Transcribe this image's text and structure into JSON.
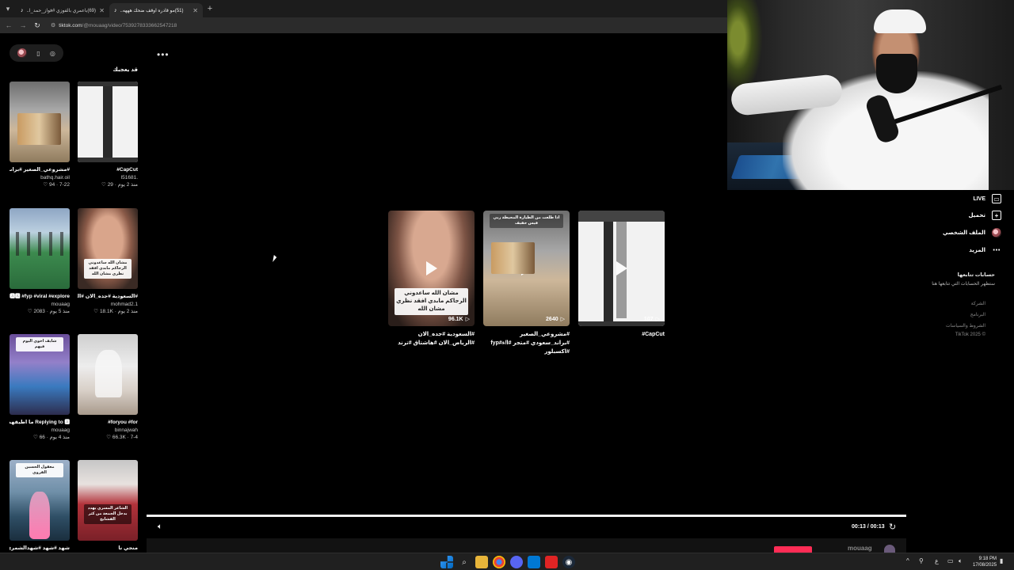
{
  "browser": {
    "tabs": [
      {
        "title": "(69)باعمري بالفوزي #فواز_حمد_ا..",
        "active": false
      },
      {
        "title": "(51)مو قادره اوقف ضحك هههه..",
        "active": true
      }
    ],
    "new_tab": "+",
    "url_host": "tiktok.com",
    "url_path": "/@mouaag/video/7539278333662547218"
  },
  "header": {
    "more": "•••"
  },
  "related": {
    "title": "قد يعجبك",
    "items": [
      {
        "caption": "CapCut#",
        "author": "I51681.",
        "meta": "29 · منذ 2 يوم"
      },
      {
        "caption": "#مشروعي_الصغير #براند_سعودي #متجر...",
        "author": "bathq.hair.oil",
        "meta": "94 · 7-22"
      },
      {
        "caption": "#السعودية #جده_الان #الرياض_الان #هاشتاق...",
        "author": "mohmad2.1",
        "meta": "18.1K · منذ 2 يوم",
        "overlay": "مشان الله ساعدوني الرجاكم مابدي افقد نظري مشان الله"
      },
      {
        "caption": "tu# 🅰🅰🅰 #fyp #viral #explore...",
        "author": "mouaag",
        "meta": "2083 · منذ 5 يوم"
      },
      {
        "caption": "foryou #for#",
        "author": "binnajwah",
        "meta": "66.3K · 7-4"
      },
      {
        "caption": "Replying to 🅰 ما اطيقهم بحلقراك 🅰 #fyp# tu...",
        "author": "mouaag",
        "meta": "66 · منذ 4 يوم",
        "overlay": "شايف اخوي اليوم فيهم"
      },
      {
        "caption": "منجي نا",
        "author": "",
        "meta": "",
        "overlay": "الشاعر المسري يهدد بدخل الجمعة من كثر الفشايخ"
      },
      {
        "caption": "شهد #شهد #شهدالشمري",
        "author": "",
        "meta": "",
        "overlay": "معقول الحسين القروي"
      }
    ]
  },
  "main_videos": [
    {
      "views": "107",
      "caption": "CapCut#"
    },
    {
      "views": "2640",
      "caption": "#مشروعي_الصغير #براند_سعودي #متجر #ا/ء#fyp #اكسبلور"
    },
    {
      "views": "96.1K",
      "caption": "#السعودية #جده_الان #الرياض_الان #هاشتاق #ترند",
      "overlay": "مشان الله ساعدوني الرجاكم مابدي افقد نظري مشان الله"
    }
  ],
  "overlay_top": "اذا طلعت من الطيارة المحيطة ربي فيس خفيف",
  "player": {
    "time": "00:13 / 00:13",
    "username_peek": "mouaag"
  },
  "sidebar": {
    "live": "LIVE",
    "upload": "تحميل",
    "profile": "الملف الشخصي",
    "more": "المزيد",
    "following_title": "حسابات تتابعها",
    "following_sub": "ستظهر الحسابات التي تتابعها هنا",
    "footer": [
      "الشركة",
      "البرنامج",
      "الشروط والسياسات",
      "© TikTok 2025"
    ]
  },
  "taskbar": {
    "time": "9:18 PM",
    "date": "17/08/2025",
    "lang": "ع"
  },
  "colors": {
    "accent": "#fe2c55",
    "background": "#000000"
  }
}
